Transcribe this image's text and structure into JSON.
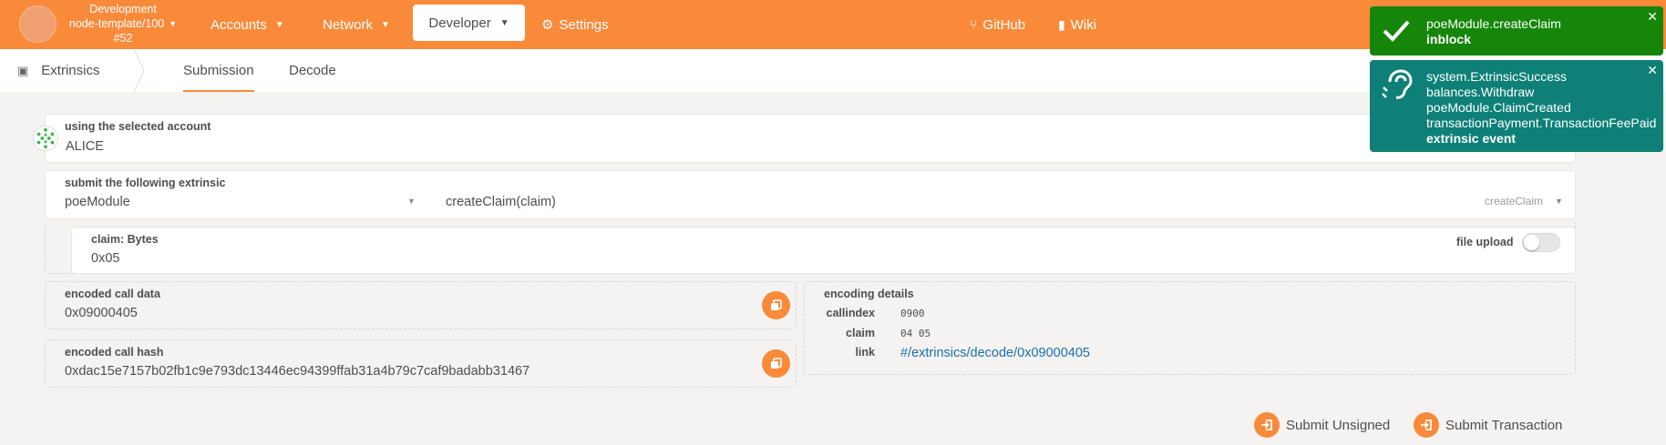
{
  "chain": {
    "name": "Development",
    "runtime": "node-template/100",
    "block": "#52"
  },
  "nav": {
    "accounts": "Accounts",
    "network": "Network",
    "developer": "Developer",
    "settings": "Settings",
    "github": "GitHub",
    "wiki": "Wiki"
  },
  "subnav": {
    "section": "Extrinsics",
    "tabs": [
      "Submission",
      "Decode"
    ]
  },
  "form": {
    "account_label": "using the selected account",
    "account_value": "ALICE",
    "extrinsic_label": "submit the following extrinsic",
    "module_value": "poeModule",
    "call_value": "createClaim(claim)",
    "call_selected": "createClaim",
    "param_label": "claim: Bytes",
    "param_value": "0x05",
    "file_upload_label": "file upload",
    "encoded_call_data_label": "encoded call data",
    "encoded_call_data": "0x09000405",
    "encoded_call_hash_label": "encoded call hash",
    "encoded_call_hash": "0xdac15e7157b02fb1c9e793dc13446ec94399ffab31a4b79c7caf9badabb31467"
  },
  "encoding": {
    "title": "encoding details",
    "callindex_label": "callindex",
    "callindex": "0900",
    "claim_label": "claim",
    "claim": "04 05",
    "link_label": "link",
    "link": "#/extrinsics/decode/0x09000405"
  },
  "actions": {
    "submit_unsigned": "Submit Unsigned",
    "submit_transaction": "Submit Transaction"
  },
  "toasts": [
    {
      "lines": [
        "poeModule.createClaim"
      ],
      "status": "inblock",
      "color": "#16860a"
    },
    {
      "lines": [
        "system.ExtrinsicSuccess",
        "balances.Withdraw",
        "poeModule.ClaimCreated",
        "transactionPayment.TransactionFeePaid"
      ],
      "status": "extrinsic event",
      "color": "#0e8077"
    }
  ],
  "colors": {
    "accent": "#f98a3a",
    "link": "#1a6fb0"
  }
}
